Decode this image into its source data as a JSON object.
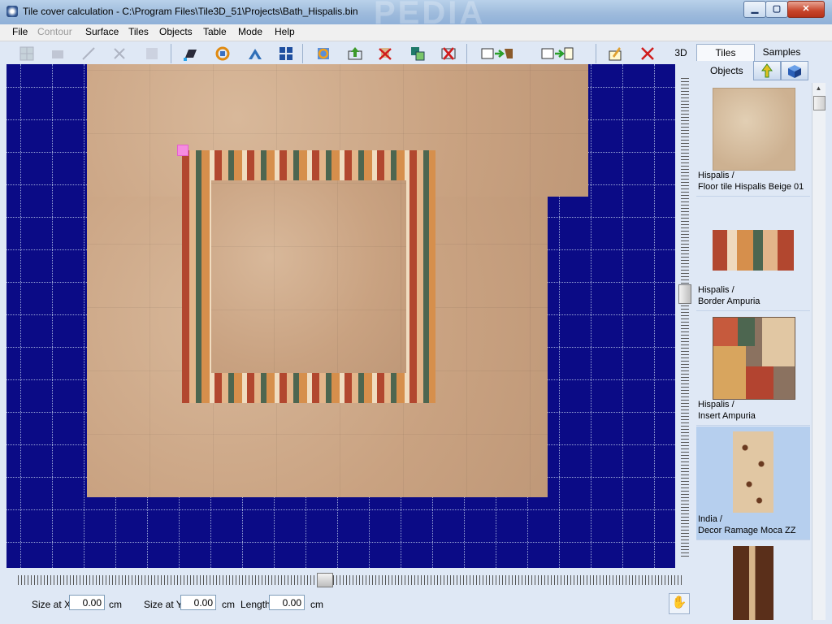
{
  "window": {
    "title": "Tile cover calculation - C:\\Program Files\\Tile3D_51\\Projects\\Bath_Hispalis.bin",
    "watermark": "PEDIA",
    "controls": {
      "minimize": "▁",
      "maximize": "▢",
      "close": "✕"
    }
  },
  "menu": [
    "File",
    "Contour",
    "Surface",
    "Tiles",
    "Objects",
    "Table",
    "Mode",
    "Help"
  ],
  "menu_disabled": [
    "Contour"
  ],
  "toolbar": {
    "mode_3d_label": "3D"
  },
  "bottom": {
    "size_x_label": "Size at X",
    "size_x_value": "0.00",
    "size_x_unit": "cm",
    "size_y_label": "Size at Y",
    "size_y_value": "0.00",
    "size_y_unit": "cm",
    "length_label": "Length",
    "length_value": "0.00",
    "length_unit": "cm",
    "hand_icon": "✋"
  },
  "panel": {
    "tabs": [
      "Tiles",
      "Samples"
    ],
    "active_tab": "Tiles",
    "objects_label": "Objects",
    "items": [
      {
        "line1": "Hispalis /",
        "line2": "Floor tile Hispalis Beige 01"
      },
      {
        "line1": "Hispalis /",
        "line2": "Border Ampuria"
      },
      {
        "line1": "Hispalis /",
        "line2": "Insert Ampuria"
      },
      {
        "line1": "India /",
        "line2": "Decor Ramage Moca ZZ",
        "selected": true
      },
      {
        "line1": "",
        "line2": ""
      }
    ]
  },
  "colors": {
    "canvas_bg": "#0b0b86",
    "panel_bg": "#dfe8f5",
    "selection_bg": "#b6cfee"
  }
}
